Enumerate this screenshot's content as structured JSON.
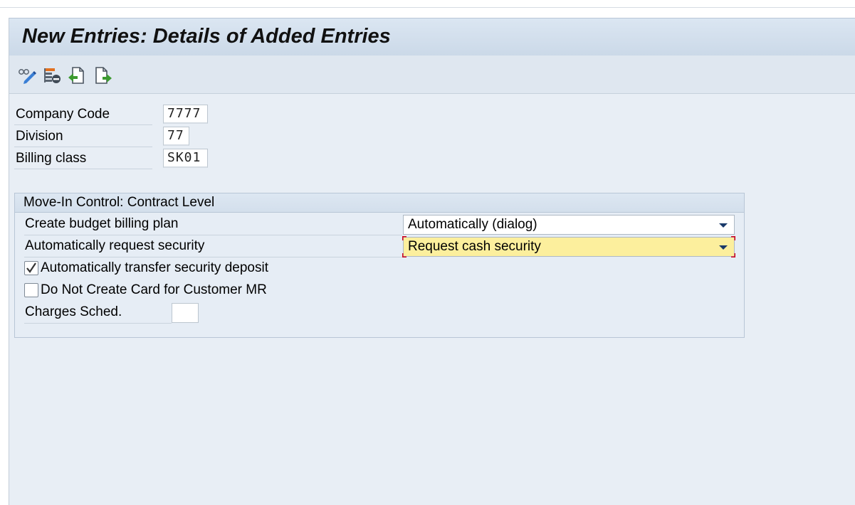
{
  "screen": {
    "title": "New Entries: Details of Added Entries"
  },
  "toolbar": {
    "icons": [
      "display-change-icon",
      "delete-icon",
      "previous-entry-icon",
      "next-entry-icon"
    ]
  },
  "key_fields": [
    {
      "label": "Company Code",
      "value": "7777"
    },
    {
      "label": "Division",
      "value": "77"
    },
    {
      "label": "Billing class",
      "value": "SK01"
    }
  ],
  "group": {
    "title": "Move-In Control: Contract Level",
    "budget_billing": {
      "label": "Create budget billing plan",
      "value": "Automatically (dialog)"
    },
    "request_security": {
      "label": "Automatically request security",
      "value": "Request cash security"
    },
    "transfer_deposit": {
      "label": "Automatically transfer security deposit",
      "checked": true
    },
    "no_card": {
      "label": "Do Not Create Card for Customer MR",
      "checked": false
    },
    "charges_sched": {
      "label": "Charges Sched.",
      "value": ""
    }
  },
  "colors": {
    "highlight_field": "#fcef9d",
    "focus_corner": "#d0021b",
    "background": "#e8eef5"
  }
}
